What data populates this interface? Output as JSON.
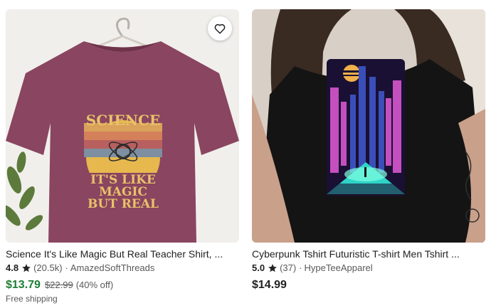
{
  "listings": [
    {
      "title": "Science It's Like Magic But Real Teacher Shirt, ...",
      "rating": "4.8",
      "reviews": "(20.5k)",
      "separator": "·",
      "shop": "AmazedSoftThreads",
      "price": "$13.79",
      "original_price": "$22.99",
      "discount": "(40% off)",
      "shipping": "Free shipping",
      "shirt_graphic": {
        "line1": "SCIENCE",
        "line2": "IT'S LIKE",
        "line3": "MAGIC",
        "line4": "BUT REAL"
      },
      "favorite_icon": "heart-outline-icon"
    },
    {
      "title": "Cyberpunk Tshirt Futuristic T-shirt Men Tshirt ...",
      "rating": "5.0",
      "reviews": "(37)",
      "separator": "·",
      "shop": "HypeTeeApparel",
      "price": "$14.99"
    }
  ],
  "colors": {
    "sale_price": "#1e7e34",
    "shirt_maroon": "#8a4560",
    "shirt_black": "#141414",
    "accent_pink": "#c44fbf",
    "accent_cyan": "#2fd4c8"
  }
}
